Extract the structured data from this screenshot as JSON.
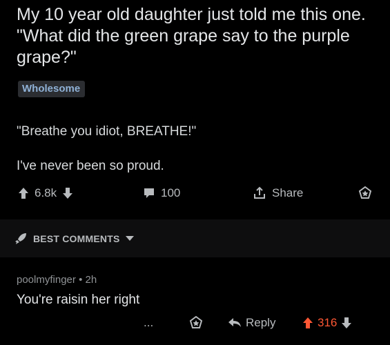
{
  "post": {
    "title": "My 10 year old daughter just told me this one. \"What did the green grape say to the purple grape?\"",
    "flair": "Wholesome",
    "body_quote": "\"Breathe you idiot, BREATHE!\"",
    "body_line2": "I've never been so proud.",
    "upvotes": "6.8k",
    "comments": "100",
    "share_label": "Share"
  },
  "sort": {
    "label": "BEST COMMENTS"
  },
  "comment": {
    "author": "poolmyfinger",
    "separator": "•",
    "age": "2h",
    "text": "You're raisin her right",
    "more": "...",
    "reply_label": "Reply",
    "score": "316"
  },
  "colors": {
    "background": "#000000",
    "flair_text": "#8fb1d6",
    "upvote_active": "#ff5734"
  },
  "icons": [
    "upvote-icon",
    "downvote-icon",
    "comment-icon",
    "share-icon",
    "award-icon",
    "rocket-icon",
    "caret-down-icon",
    "reply-icon"
  ]
}
